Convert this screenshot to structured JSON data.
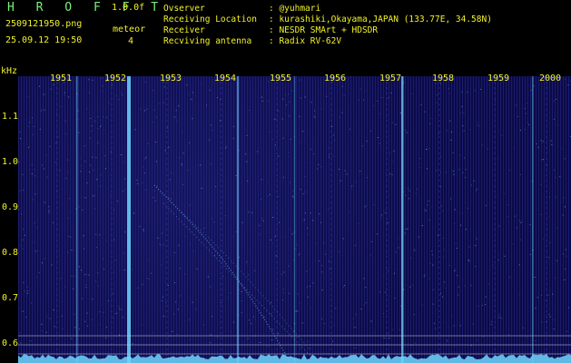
{
  "header": {
    "app_title": "H R O F F T",
    "version": "1.0.0f",
    "filename": "2509121950.png",
    "timestamp": "25.09.12 19:50",
    "meteor_label": "meteor",
    "meteor_count": "4"
  },
  "info": [
    {
      "label": "Ovserver",
      "value": ": @yuhmari"
    },
    {
      "label": "Receiving Location",
      "value": ": kurashiki,Okayama,JAPAN (133.77E, 34.58N)"
    },
    {
      "label": "Receiver",
      "value": ": NESDR SMArt + HDSDR"
    },
    {
      "label": "Recviving antenna",
      "value": ": Radix RV-62V"
    }
  ],
  "spectrogram": {
    "y_unit": "kHz",
    "y_ticks": [
      "1.1",
      "1.0",
      "0.9",
      "0.8",
      "0.7",
      "0.6"
    ],
    "x_ticks": [
      "1951",
      "1952",
      "1953",
      "1954",
      "1955",
      "1956",
      "1957",
      "1958",
      "1959",
      "2000"
    ],
    "colors": {
      "background": "#0b0b55",
      "signal": "#6fd6ff",
      "text": "#f2f22a",
      "title": "#7cf07c"
    }
  }
}
